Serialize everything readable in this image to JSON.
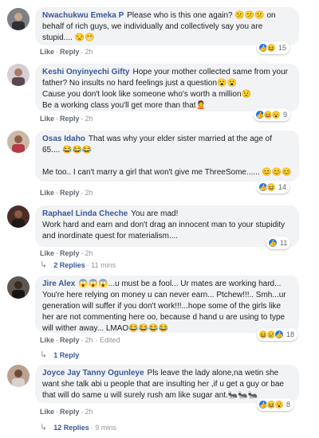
{
  "comments": [
    {
      "author": "Nwachukwu Emeka P",
      "text": "Please who is this one again? 😕😕😕 on behalf of rich guys, we individually and collectively say you are stupid.... 😒😬",
      "like": "Like",
      "reply": "Reply",
      "time": "2h",
      "reaction_count": "15",
      "avatar_color": "#8a8d91"
    },
    {
      "author": "Keshi Onyinyechi Gifty",
      "text": "Hope your mother collected same from your father? No insults no hard feelings just a question😮😮\nCause you don't look like someone who's worth a million😟\nBe a working class you'll get more than that🙎",
      "like": "Like",
      "reply": "Reply",
      "time": "2h",
      "reaction_count": "9",
      "avatar_color": "#b9a9b0"
    },
    {
      "author": "Osas Idaho",
      "text": "That was why your elder sister married at the age of 65.... 😂😂😂\n\nMe too.. I can't marry a girl that won't give me ThreeSome...... 😊😊😊",
      "like": "Like",
      "reply": "Reply",
      "time": "2h",
      "reaction_count": "14",
      "avatar_color": "#a3897a"
    },
    {
      "author": "Raphael Linda Cheche",
      "text": "You are mad!\nWork hard and earn and don't drag an innocent man to your stupidity and inordinate quest for materialism....",
      "like": "Like",
      "reply": "Reply",
      "time": "2h",
      "reaction_count": "11",
      "avatar_color": "#5b3a2e",
      "replies_label": "2 Replies",
      "replies_time": "· 11 mins"
    },
    {
      "author": "Jire Alex",
      "text": "😱😱😱...u must be a fool... Ur mates are working hard... You're here relying on money u can never earn... Ptchew!!!.. Smh...ur generation will suffer if you don't work!!!...hope some of the girls like her are not commenting here oo, because d hand u are using to type will wither away... LMAO😂😂😂😂",
      "like": "Like",
      "reply": "Reply",
      "time": "2h",
      "edited": "· Edited",
      "reaction_count": "18",
      "avatar_color": "#3e3a38",
      "replies_label": "1 Reply"
    },
    {
      "author": "Joyce Jay Tanny Ogunleye",
      "text": "Pls leave the lady alone,na wetin she want she talk abi u people that are insulting her ,if u get a guy or bae that will do same u will surely rush am like sugar ant.🐜🐜🐜",
      "like": "Like",
      "reply": "Reply",
      "time": "2h",
      "reaction_count": "8",
      "avatar_color": "#9a7c6e",
      "replies_label": "12 Replies",
      "replies_time": "· 9 mins"
    }
  ],
  "colors": {
    "link": "#385898",
    "bubble": "#f2f3f5",
    "like_blue": "#1877f2",
    "emoji_yellow": "#f7c433"
  },
  "icons": [
    "like-reaction-icon",
    "haha-reaction-icon",
    "wow-reaction-icon",
    "sad-reaction-icon",
    "reply-arrow-icon"
  ]
}
